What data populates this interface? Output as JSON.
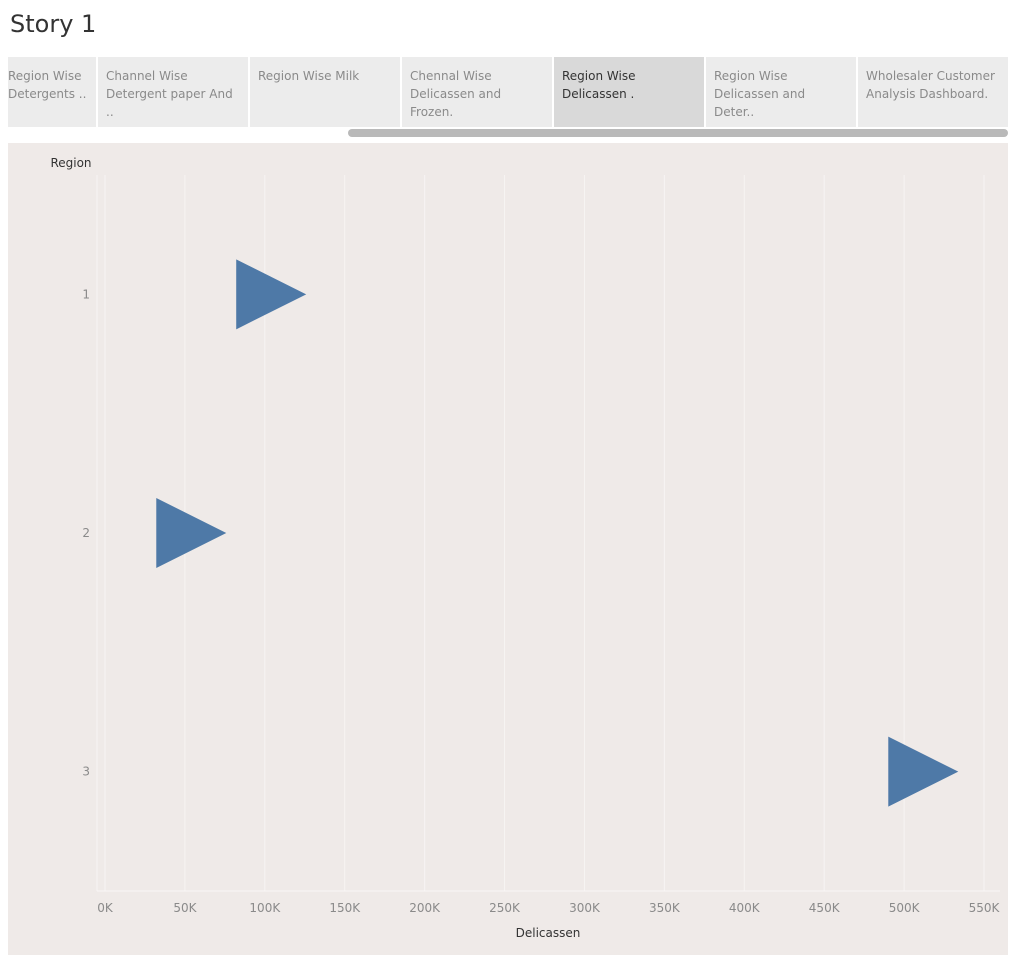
{
  "story": {
    "title": "Story 1"
  },
  "tabs": [
    {
      "label": "Region Wise\nDetergents ..",
      "active": false
    },
    {
      "label": "Channel Wise\nDetergent paper And ..",
      "active": false
    },
    {
      "label": "Region  Wise Milk",
      "active": false
    },
    {
      "label": "Chennal Wise\nDelicassen and Frozen.",
      "active": false
    },
    {
      "label": "Region Wise\nDelicassen .",
      "active": true
    },
    {
      "label": "Region Wise\nDelicassen and Deter..",
      "active": false
    },
    {
      "label": "Wholesaler Customer\nAnalysis Dashboard.",
      "active": false
    }
  ],
  "colors": {
    "mark": "#4e79a7",
    "chart_bg": "#efeae8",
    "grid": "#f7f4f3",
    "tick_text": "#8a8a8a",
    "label_text": "#333333"
  },
  "chart_data": {
    "type": "scatter",
    "mark_shape": "triangle-right",
    "ylabel": "Region",
    "xlabel": "Delicassen",
    "categories": [
      "1",
      "2",
      "3"
    ],
    "values": [
      104000,
      54000,
      512000
    ],
    "xlim": [
      -5000,
      560000
    ],
    "xticks": [
      0,
      50000,
      100000,
      150000,
      200000,
      250000,
      300000,
      350000,
      400000,
      450000,
      500000,
      550000
    ],
    "xtick_labels": [
      "0K",
      "50K",
      "100K",
      "150K",
      "200K",
      "250K",
      "300K",
      "350K",
      "400K",
      "450K",
      "500K",
      "550K"
    ],
    "grid": "vertical"
  }
}
